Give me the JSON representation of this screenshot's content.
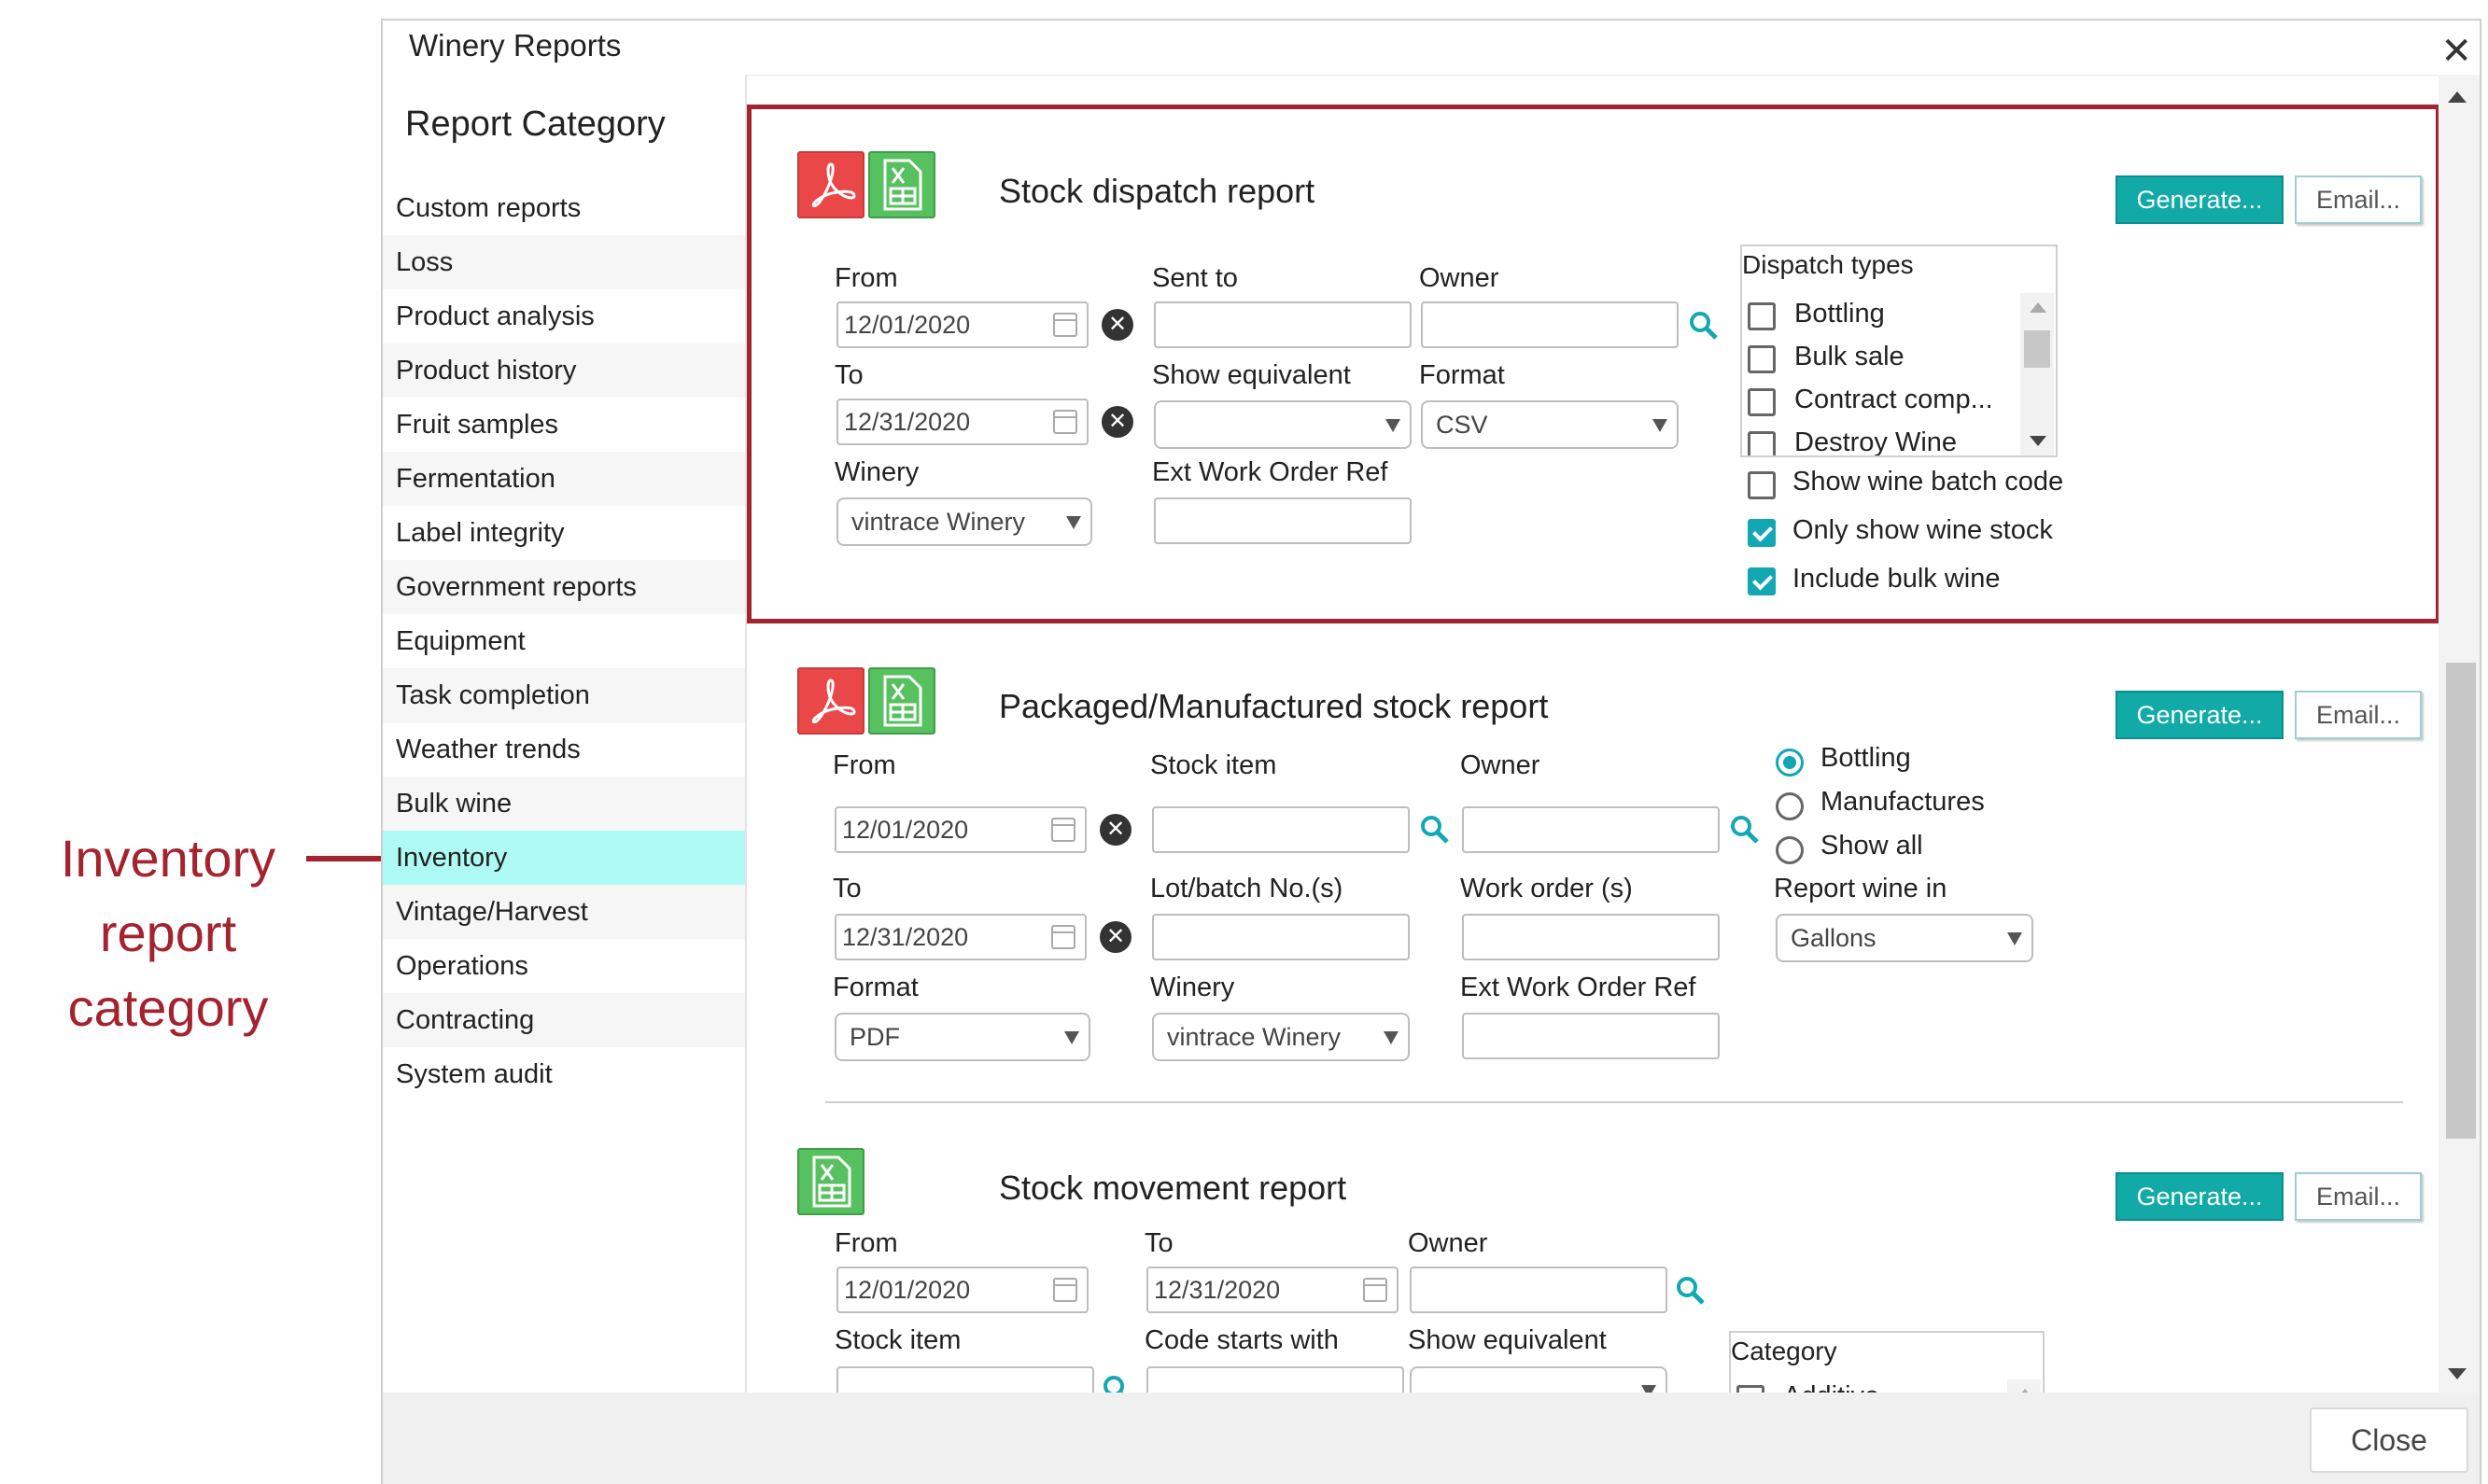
{
  "annotation": {
    "text": "Inventory report category"
  },
  "window": {
    "title": "Winery Reports",
    "close_label": "Close"
  },
  "sidebar": {
    "title": "Report Category",
    "items": [
      "Custom reports",
      "Loss",
      "Product analysis",
      "Product history",
      "Fruit samples",
      "Fermentation",
      "Label integrity",
      "Government reports",
      "Equipment",
      "Task completion",
      "Weather trends",
      "Bulk wine",
      "Inventory",
      "Vintage/Harvest",
      "Operations",
      "Contracting",
      "System audit"
    ],
    "active": "Inventory"
  },
  "buttons": {
    "generate": "Generate...",
    "email": "Email..."
  },
  "stock_dispatch": {
    "title": "Stock dispatch report",
    "from_label": "From",
    "from_value": "12/01/2020",
    "to_label": "To",
    "to_value": "12/31/2020",
    "winery_label": "Winery",
    "winery_value": "vintrace Winery",
    "sent_to_label": "Sent to",
    "sent_to_value": "",
    "show_equivalent_label": "Show equivalent",
    "show_equivalent_value": "",
    "ext_work_order_label": "Ext Work Order Ref",
    "ext_work_order_value": "",
    "owner_label": "Owner",
    "owner_value": "",
    "format_label": "Format",
    "format_value": "CSV",
    "dispatch_types_label": "Dispatch types",
    "dispatch_types": [
      {
        "label": "Bottling",
        "checked": false
      },
      {
        "label": "Bulk sale",
        "checked": false
      },
      {
        "label": "Contract comp...",
        "checked": false
      },
      {
        "label": "Destroy Wine",
        "checked": false
      }
    ],
    "options": [
      {
        "label": "Show wine batch code",
        "checked": false
      },
      {
        "label": "Only show wine stock",
        "checked": true
      },
      {
        "label": "Include bulk wine",
        "checked": true
      }
    ]
  },
  "packaged_stock": {
    "title": "Packaged/Manufactured stock report",
    "from_label": "From",
    "from_value": "12/01/2020",
    "to_label": "To",
    "to_value": "12/31/2020",
    "format_label": "Format",
    "format_value": "PDF",
    "stock_item_label": "Stock item",
    "stock_item_value": "",
    "lot_batch_label": "Lot/batch No.(s)",
    "lot_batch_value": "",
    "winery_label": "Winery",
    "winery_value": "vintrace Winery",
    "owner_label": "Owner",
    "owner_value": "",
    "work_order_label": "Work order (s)",
    "work_order_value": "",
    "ext_work_order_label": "Ext Work Order Ref",
    "ext_work_order_value": "",
    "radio_options": [
      {
        "label": "Bottling",
        "checked": true
      },
      {
        "label": "Manufactures",
        "checked": false
      },
      {
        "label": "Show all",
        "checked": false
      }
    ],
    "report_wine_in_label": "Report wine in",
    "report_wine_in_value": "Gallons"
  },
  "stock_movement": {
    "title": "Stock movement report",
    "from_label": "From",
    "from_value": "12/01/2020",
    "to_label": "To",
    "to_value": "12/31/2020",
    "owner_label": "Owner",
    "owner_value": "",
    "stock_item_label": "Stock item",
    "code_starts_label": "Code starts with",
    "show_equivalent_label": "Show equivalent",
    "category_label": "Category",
    "categories": [
      {
        "label": "Additive",
        "checked": false
      }
    ]
  },
  "colors": {
    "accent": "#11aaa6",
    "highlight": "#a3232e",
    "active_bg": "#aefbf5",
    "pdf": "#ea4848",
    "xls": "#57c05f"
  }
}
